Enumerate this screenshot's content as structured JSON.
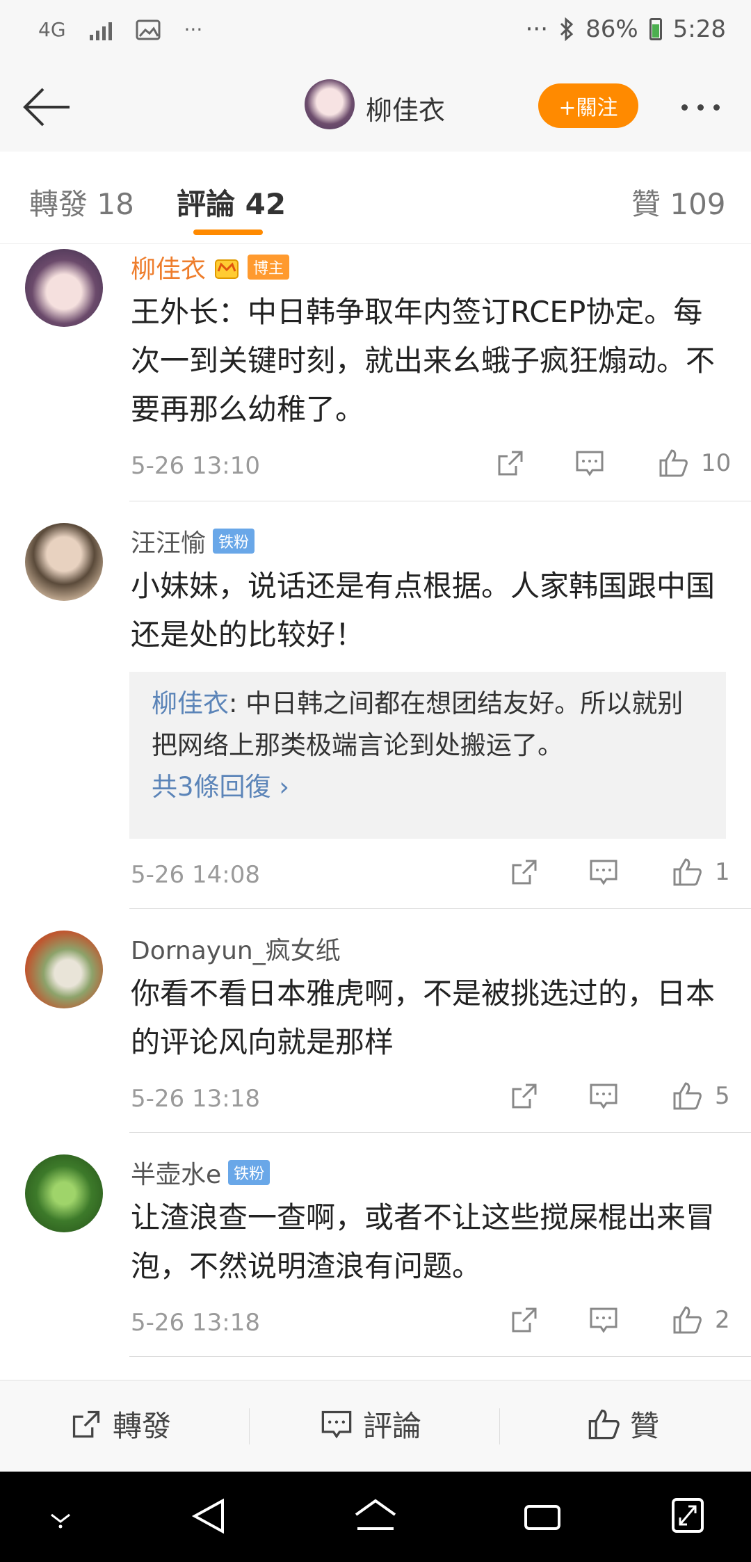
{
  "status": {
    "network": "4G",
    "battery": "86%",
    "time": "5:28"
  },
  "header": {
    "user_name": "柳佳衣",
    "follow_label": "+關注"
  },
  "tabs": [
    {
      "label": "轉發 18"
    },
    {
      "label": "評論 42"
    },
    {
      "label": "贊 109"
    }
  ],
  "comments": [
    {
      "user": "柳佳衣",
      "badge": "博主",
      "text": "王外长：中日韩争取年内签订RCEP协定。每次一到关键时刻，就出来幺蛾子疯狂煽动。不要再那么幼稚了。",
      "time": "5-26 13:10",
      "likes": "10"
    },
    {
      "user": "汪汪愉",
      "badge": "铁粉",
      "text": "小妹妹，说话还是有点根据。人家韩国跟中国还是处的比较好！",
      "reply_user": "柳佳衣",
      "reply_text": ": 中日韩之间都在想团结友好。所以就别把网络上那类极端言论到处搬运了。",
      "reply_more": "共3條回復 ›",
      "time": "5-26 14:08",
      "likes": "1"
    },
    {
      "user": "Dornayun_疯女纸",
      "text": "你看不看日本雅虎啊，不是被挑选过的，日本的评论风向就是那样",
      "time": "5-26 13:18",
      "likes": "5"
    },
    {
      "user": "半壶水e",
      "badge": "铁粉",
      "text": "让渣浪查一查啊，或者不让这些搅屎棍出来冒泡，不然说明渣浪有问题。",
      "time": "5-26 13:18",
      "likes": "2"
    }
  ],
  "bottom_bar": {
    "repost": "轉發",
    "comment": "評論",
    "like": "贊"
  }
}
